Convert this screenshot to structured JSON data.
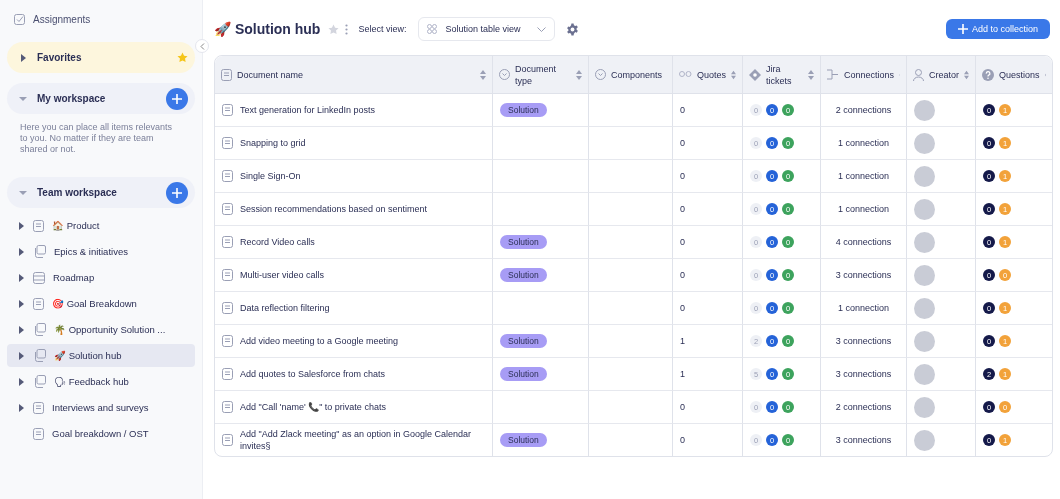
{
  "sidebar": {
    "top_items": [
      {
        "label": "Assignments"
      }
    ],
    "favorites": {
      "label": "Favorites",
      "expanded": false
    },
    "my_workspace": {
      "label": "My workspace",
      "expanded": true,
      "description": "Here you can place all items relevants to you. No matter if they are team shared or not."
    },
    "team_workspace": {
      "label": "Team workspace",
      "expanded": true,
      "items": [
        {
          "label": "🏠 Product",
          "kind": "document",
          "expandable": true,
          "selected": false
        },
        {
          "label": "Epics & initiatives",
          "kind": "collection",
          "expandable": true,
          "selected": false
        },
        {
          "label": "Roadmap",
          "kind": "database",
          "expandable": true,
          "selected": false
        },
        {
          "label": "🎯 Goal Breakdown",
          "kind": "document",
          "expandable": true,
          "selected": false
        },
        {
          "label": "🌴 Opportunity Solution ...",
          "kind": "collection",
          "expandable": true,
          "selected": false
        },
        {
          "label": "🚀 Solution hub",
          "kind": "collection",
          "expandable": true,
          "selected": true
        },
        {
          "label": "🗣 Feedback hub",
          "kind": "collection",
          "expandable": true,
          "selected": false
        },
        {
          "label": "Interviews and surveys",
          "kind": "document",
          "expandable": true,
          "selected": false
        },
        {
          "label": "Goal breakdown / OST",
          "kind": "document",
          "expandable": false,
          "selected": false
        }
      ]
    }
  },
  "header": {
    "title": "🚀 Solution hub",
    "favorite": false,
    "view_label": "Select view:",
    "view_value": "Solution table view",
    "add_button": "Add to collection"
  },
  "table": {
    "columns": [
      {
        "label": "Document name"
      },
      {
        "label": "Document type"
      },
      {
        "label": "Components"
      },
      {
        "label": "Quotes"
      },
      {
        "label": "Jira tickets"
      },
      {
        "label": "Connections"
      },
      {
        "label": "Creator"
      },
      {
        "label": "Questions"
      }
    ],
    "rows": [
      {
        "name": "Text generation for LinkedIn posts",
        "type": "Solution",
        "quotes": "0",
        "jira": [
          "0",
          "0",
          "0"
        ],
        "connections": "2 connections",
        "questions": [
          "0",
          "1"
        ]
      },
      {
        "name": "Snapping to grid",
        "quotes": "0",
        "jira": [
          "0",
          "0",
          "0"
        ],
        "connections": "1 connection",
        "questions": [
          "0",
          "1"
        ]
      },
      {
        "name": "Single Sign-On",
        "quotes": "0",
        "jira": [
          "0",
          "0",
          "0"
        ],
        "connections": "1 connection",
        "questions": [
          "0",
          "1"
        ]
      },
      {
        "name": "Session recommendations based on sentiment",
        "quotes": "0",
        "jira": [
          "0",
          "0",
          "0"
        ],
        "connections": "1 connection",
        "questions": [
          "0",
          "1"
        ]
      },
      {
        "name": "Record Video calls",
        "type": "Solution",
        "quotes": "0",
        "jira": [
          "0",
          "0",
          "0"
        ],
        "connections": "4 connections",
        "questions": [
          "0",
          "1"
        ]
      },
      {
        "name": "Multi-user video calls",
        "type": "Solution",
        "quotes": "0",
        "jira": [
          "0",
          "0",
          "0"
        ],
        "connections": "3 connections",
        "questions": [
          "0",
          "0"
        ]
      },
      {
        "name": "Data reflection filtering",
        "quotes": "0",
        "jira": [
          "0",
          "0",
          "0"
        ],
        "connections": "1 connection",
        "questions": [
          "0",
          "1"
        ]
      },
      {
        "name": "Add video meeting to a Google meeting",
        "type": "Solution",
        "quotes": "1",
        "jira": [
          "2",
          "0",
          "0"
        ],
        "connections": "3 connections",
        "questions": [
          "0",
          "1"
        ]
      },
      {
        "name": "Add quotes to Salesforce from chats",
        "type": "Solution",
        "quotes": "1",
        "jira": [
          "5",
          "0",
          "0"
        ],
        "connections": "3 connections",
        "questions": [
          "2",
          "1"
        ]
      },
      {
        "name": "Add \"Call 'name' 📞\" to private chats",
        "quotes": "0",
        "jira": [
          "0",
          "0",
          "0"
        ],
        "connections": "2 connections",
        "questions": [
          "0",
          "0"
        ]
      },
      {
        "name": "Add \"Add Zlack meeting\" as an option in Google Calendar invites§",
        "type": "Solution",
        "quotes": "0",
        "jira": [
          "0",
          "0",
          "0"
        ],
        "connections": "3 connections",
        "questions": [
          "0",
          "1"
        ]
      }
    ]
  }
}
